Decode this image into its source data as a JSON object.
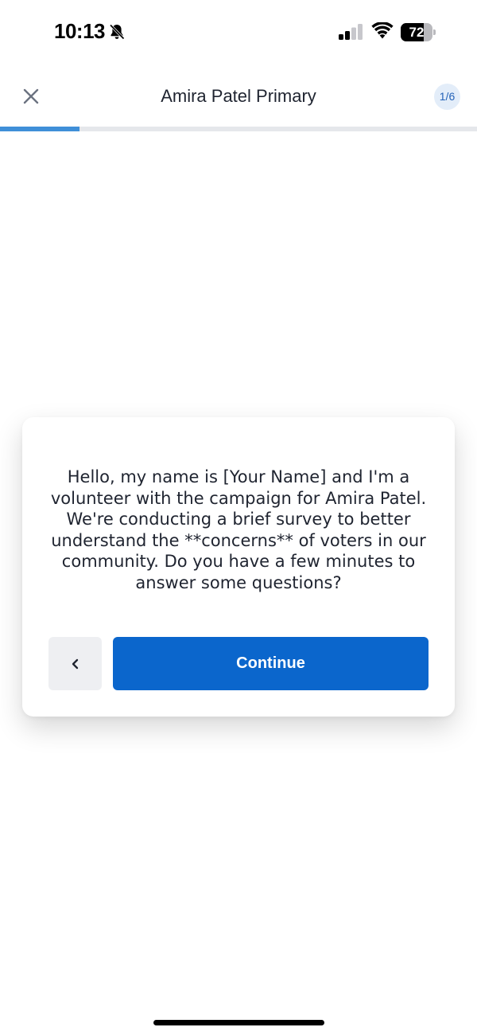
{
  "status_bar": {
    "time": "10:13",
    "icons": [
      "bell-off-icon",
      "signal-icon",
      "wifi-icon",
      "battery-icon"
    ],
    "battery_level": "72",
    "battery_fraction": 0.72
  },
  "header": {
    "title": "Amira Patel Primary",
    "step_badge": "1/6",
    "close_icon": "close-icon"
  },
  "progress": {
    "fraction": 0.1667,
    "track_color": "#e5e7eb",
    "fill_color": "#3f8fd8"
  },
  "card": {
    "message": "Hello, my name is [Your Name] and I'm a volunteer with the campaign for Amira Patel. We're conducting a brief survey to better understand the **concerns** of voters in our community. Do you have a few minutes to answer some questions?",
    "back_icon": "chevron-left-icon",
    "continue_label": "Continue"
  },
  "colors": {
    "accent": "#0b66cc",
    "badge_bg": "#e3edf9",
    "badge_text": "#2563b8",
    "back_button_bg": "#eeeff2"
  }
}
